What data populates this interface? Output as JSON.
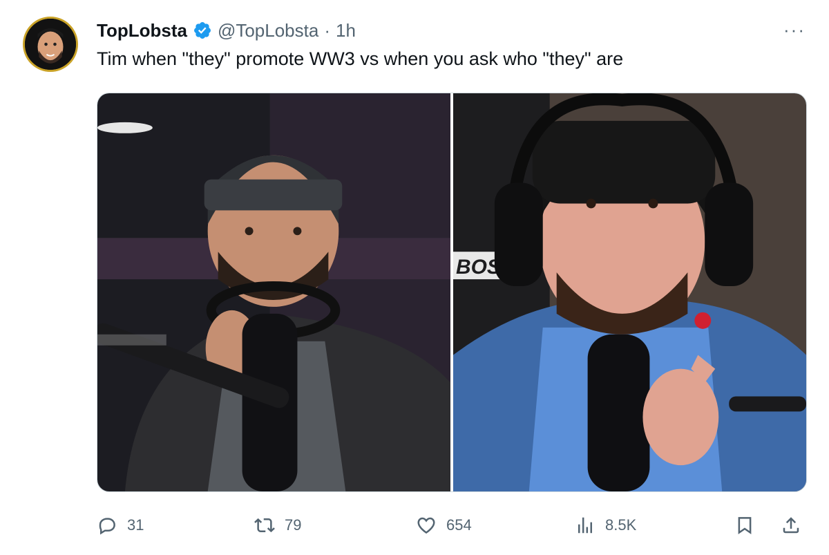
{
  "tweet": {
    "author_name": "TopLobsta",
    "handle": "@TopLobsta",
    "separator": "·",
    "time": "1h",
    "more_label": "···",
    "text": "Tim when \"they\" promote WW3 vs when you ask who \"they\" are",
    "media": [
      {
        "icon": "photo-left"
      },
      {
        "icon": "photo-right"
      }
    ]
  },
  "actions": {
    "replies": "31",
    "reposts": "79",
    "likes": "654",
    "views": "8.5K"
  },
  "colors": {
    "text": "#0f1419",
    "secondary": "#536471",
    "verified": "#1d9bf0",
    "border": "#cfd9de"
  }
}
